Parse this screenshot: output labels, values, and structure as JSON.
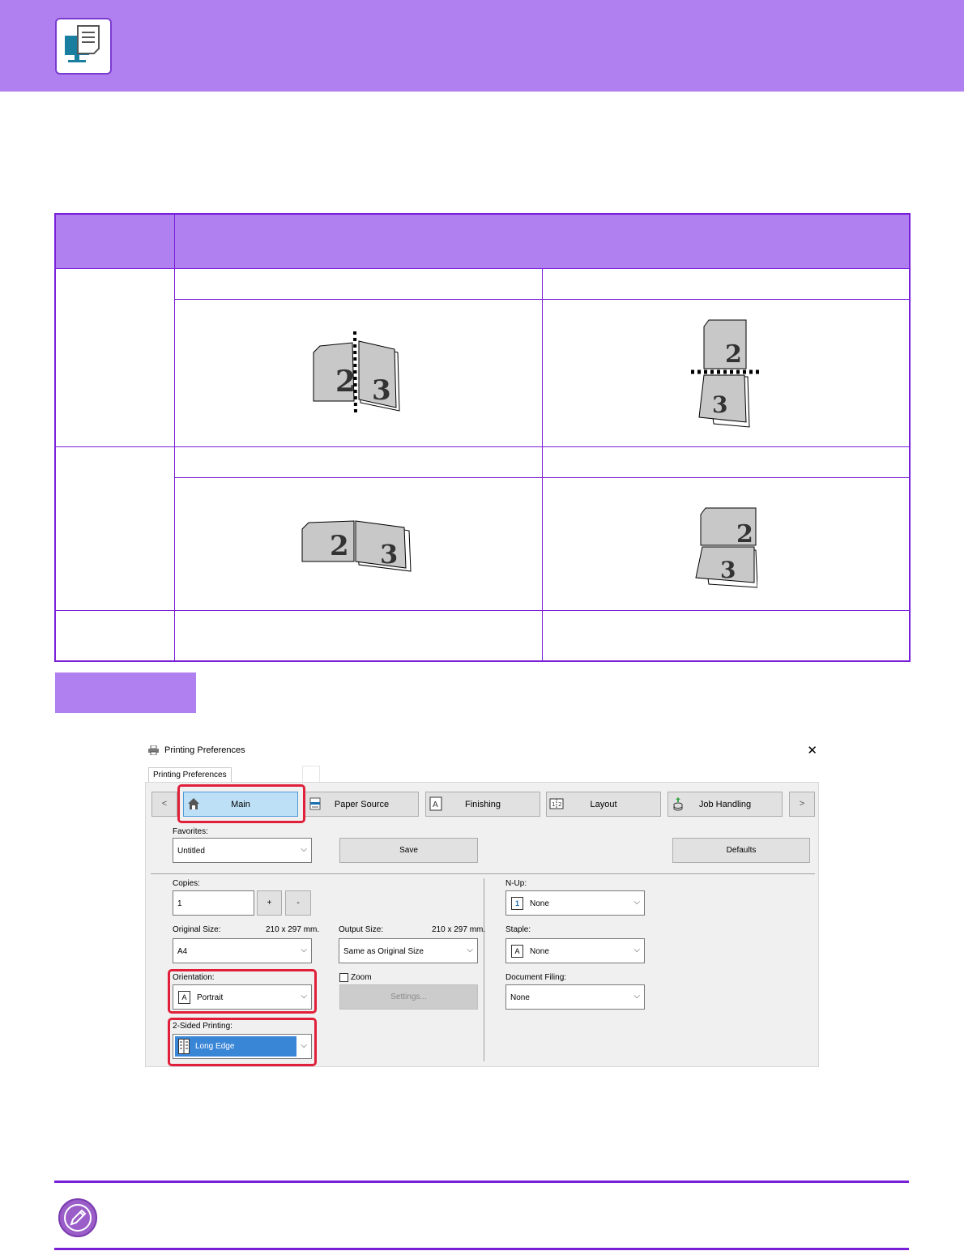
{
  "dialog": {
    "title": "Printing Preferences",
    "close_glyph": "✕",
    "tab_label": "Printing Preferences",
    "nav": {
      "prev": "<",
      "next": ">",
      "main": "Main",
      "paper_source": "Paper Source",
      "finishing": "Finishing",
      "layout": "Layout",
      "job_handling": "Job Handling"
    },
    "favorites": {
      "label": "Favorites:",
      "value": "Untitled",
      "save": "Save",
      "defaults": "Defaults"
    },
    "copies": {
      "label": "Copies:",
      "value": "1",
      "plus": "+",
      "minus": "-"
    },
    "original_size": {
      "label": "Original Size:",
      "dims": "210 x 297 mm.",
      "value": "A4"
    },
    "output_size": {
      "label": "Output Size:",
      "dims": "210 x 297 mm.",
      "value": "Same as Original Size"
    },
    "orientation": {
      "label": "Orientation:",
      "value": "Portrait",
      "icon_glyph": "A"
    },
    "zoom": {
      "label": "Zoom",
      "settings": "Settings..."
    },
    "two_sided": {
      "label": "2-Sided Printing:",
      "value": "Long Edge"
    },
    "n_up": {
      "label": "N-Up:",
      "value": "None",
      "icon_glyph": "1"
    },
    "staple": {
      "label": "Staple:",
      "value": "None",
      "icon_glyph": "A"
    },
    "document_filing": {
      "label": "Document Filing:",
      "value": "None"
    },
    "chevron_glyph": "⌵"
  },
  "colors": {
    "accent": "#b07ff0",
    "border": "#7a1fd8",
    "highlight": "#e0203a"
  }
}
